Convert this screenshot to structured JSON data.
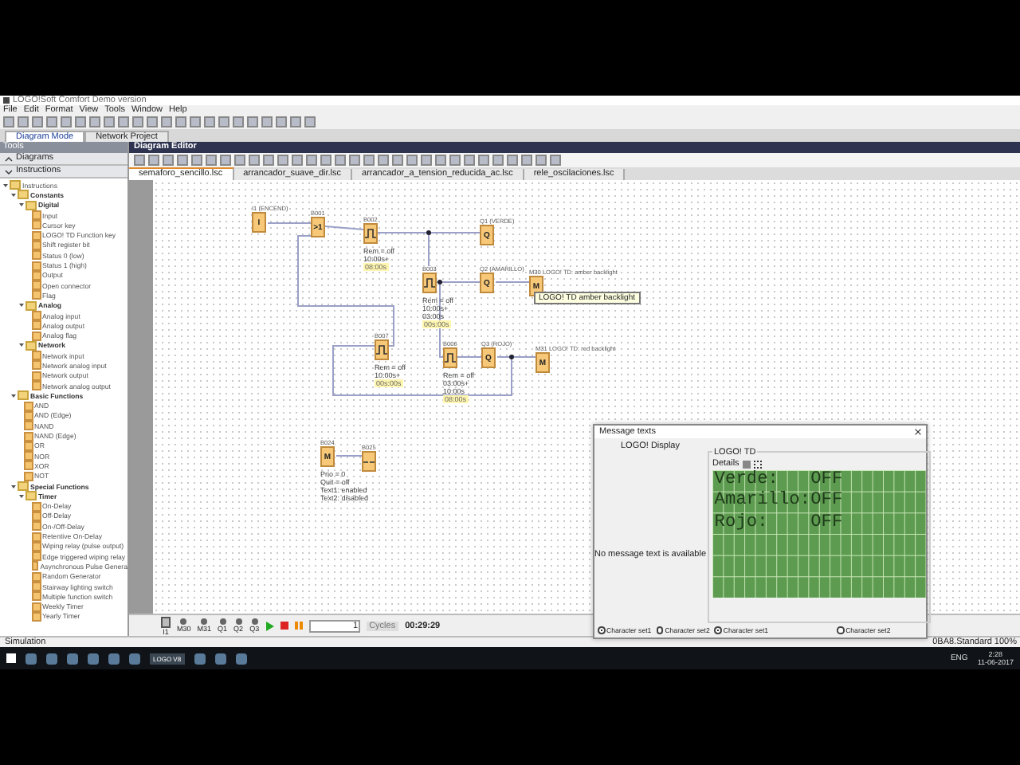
{
  "window": {
    "title": "LOGO!Soft Comfort Demo version"
  },
  "menu": [
    "File",
    "Edit",
    "Format",
    "View",
    "Tools",
    "Window",
    "Help"
  ],
  "mode_tabs": [
    {
      "label": "Diagram Mode",
      "selected": true
    },
    {
      "label": "Network Project",
      "selected": false
    }
  ],
  "tools_panel": {
    "title": "Tools",
    "sections": [
      {
        "label": "Diagrams",
        "expanded": false
      },
      {
        "label": "Instructions",
        "expanded": true
      }
    ],
    "tree": [
      {
        "label": "Instructions",
        "expanded": true,
        "children": [
          {
            "label": "Constants",
            "expanded": true,
            "children": [
              {
                "label": "Digital",
                "expanded": true,
                "children": [
                  {
                    "label": "Input"
                  },
                  {
                    "label": "Cursor key"
                  },
                  {
                    "label": "LOGO! TD Function key"
                  },
                  {
                    "label": "Shift register bit"
                  },
                  {
                    "label": "Status 0 (low)"
                  },
                  {
                    "label": "Status 1 (high)"
                  },
                  {
                    "label": "Output"
                  },
                  {
                    "label": "Open connector"
                  },
                  {
                    "label": "Flag"
                  }
                ]
              },
              {
                "label": "Analog",
                "expanded": true,
                "children": [
                  {
                    "label": "Analog input"
                  },
                  {
                    "label": "Analog output"
                  },
                  {
                    "label": "Analog flag"
                  }
                ]
              },
              {
                "label": "Network",
                "expanded": true,
                "children": [
                  {
                    "label": "Network input"
                  },
                  {
                    "label": "Network analog input"
                  },
                  {
                    "label": "Network output"
                  },
                  {
                    "label": "Network analog output"
                  }
                ]
              }
            ]
          },
          {
            "label": "Basic Functions",
            "expanded": true,
            "children": [
              {
                "label": "AND"
              },
              {
                "label": "AND (Edge)"
              },
              {
                "label": "NAND"
              },
              {
                "label": "NAND (Edge)"
              },
              {
                "label": "OR"
              },
              {
                "label": "NOR"
              },
              {
                "label": "XOR"
              },
              {
                "label": "NOT"
              }
            ]
          },
          {
            "label": "Special Functions",
            "expanded": true,
            "children": [
              {
                "label": "Timer",
                "expanded": true,
                "children": [
                  {
                    "label": "On-Delay"
                  },
                  {
                    "label": "Off-Delay"
                  },
                  {
                    "label": "On-/Off-Delay"
                  },
                  {
                    "label": "Retentive On-Delay"
                  },
                  {
                    "label": "Wiping relay (pulse output)"
                  },
                  {
                    "label": "Edge triggered wiping relay"
                  },
                  {
                    "label": "Asynchronous Pulse Genera"
                  },
                  {
                    "label": "Random Generator"
                  },
                  {
                    "label": "Stairway lighting switch"
                  },
                  {
                    "label": "Multiple function switch"
                  },
                  {
                    "label": "Weekly Timer"
                  },
                  {
                    "label": "Yearly Timer"
                  }
                ]
              }
            ]
          }
        ]
      }
    ]
  },
  "editor": {
    "title": "Diagram Editor",
    "file_tabs": [
      {
        "label": "semaforo_sencillo.lsc",
        "selected": true
      },
      {
        "label": "arrancador_suave_dir.lsc",
        "selected": false
      },
      {
        "label": "arrancador_a_tension_reducida_ac.lsc",
        "selected": false
      },
      {
        "label": "rele_oscilaciones.lsc",
        "selected": false
      }
    ],
    "blocks": [
      {
        "kind": "input",
        "label": "I1 (ENCEND)",
        "symbol": "I"
      },
      {
        "kind": "gate",
        "label": "B001",
        "symbol": ">1"
      },
      {
        "kind": "timer",
        "label": "B002",
        "params": [
          "Rem = off",
          "10:00s+"
        ],
        "current": "08:00s"
      },
      {
        "kind": "output",
        "label": "Q1 (VERDE)",
        "symbol": "Q"
      },
      {
        "kind": "timer",
        "label": "B003",
        "params": [
          "Rem = off",
          "10:00s+",
          "03:00s"
        ],
        "current": "00s:00s"
      },
      {
        "kind": "output",
        "label": "Q2 (AMARILLO)",
        "symbol": "Q"
      },
      {
        "kind": "flag",
        "label": "M30 LOGO! TD: amber backlight",
        "symbol": "M"
      },
      {
        "kind": "timer",
        "label": "B007",
        "params": [
          "Rem = off",
          "10:00s+"
        ],
        "current": "00s:00s"
      },
      {
        "kind": "timer",
        "label": "B006",
        "params": [
          "Rem = off",
          "03:00s+",
          "10:00s"
        ],
        "current": "08:00s"
      },
      {
        "kind": "output",
        "label": "Q3 (ROJO)",
        "symbol": "Q"
      },
      {
        "kind": "flag",
        "label": "M31 LOGO! TD: red backlight",
        "symbol": "M"
      },
      {
        "kind": "message",
        "label": "B024",
        "symbol": "M",
        "params": [
          "Prio = 0",
          "Quit = off",
          "Text1: enabled",
          "Text2: disabled"
        ]
      },
      {
        "kind": "display",
        "label": "B025"
      }
    ],
    "tooltip": "LOGO! TD amber backlight"
  },
  "simulation": {
    "inputs": [
      {
        "label": "I1",
        "on": false
      }
    ],
    "lamps": [
      {
        "label": "M30",
        "on": false
      },
      {
        "label": "M31",
        "on": false
      },
      {
        "label": "Q1",
        "on": false
      },
      {
        "label": "Q2",
        "on": false
      },
      {
        "label": "Q3",
        "on": false
      }
    ],
    "cycles": "1",
    "cycles_unit": "Cycles",
    "time": "00:29:29"
  },
  "dialog": {
    "title": "Message texts",
    "display_label": "LOGO! Display",
    "device_label": "LOGO! TD",
    "details_label": "Details",
    "empty_text": "No message text is available",
    "lcd_lines": [
      "Verde:   OFF",
      "Amarillo:OFF",
      "Rojo:    OFF"
    ],
    "radios": [
      {
        "label": "Character set1",
        "selected": true
      },
      {
        "label": "Character set2",
        "selected": false
      },
      {
        "label": "Character set1",
        "selected": true
      },
      {
        "label": "Character set2",
        "selected": false
      }
    ]
  },
  "status_bar": {
    "left": "Simulation",
    "right": "0BA8.Standard 100%"
  },
  "taskbar": {
    "app_label": "LOGO V8",
    "language": "ENG",
    "time": "2:28",
    "date": "11-06-2017"
  }
}
